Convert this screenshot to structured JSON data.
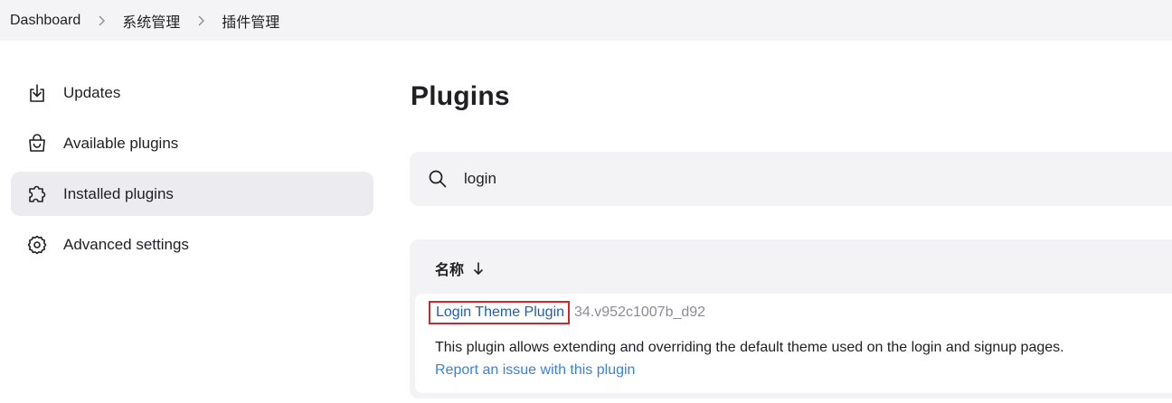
{
  "breadcrumb": {
    "items": [
      "Dashboard",
      "系统管理",
      "插件管理"
    ]
  },
  "sidebar": {
    "items": [
      {
        "label": "Updates",
        "icon": "download-icon",
        "active": false
      },
      {
        "label": "Available plugins",
        "icon": "shopping-bag-icon",
        "active": false
      },
      {
        "label": "Installed plugins",
        "icon": "puzzle-icon",
        "active": true
      },
      {
        "label": "Advanced settings",
        "icon": "gear-icon",
        "active": false
      }
    ]
  },
  "main": {
    "title": "Plugins",
    "search": {
      "value": "login",
      "icon": "search-icon"
    },
    "table": {
      "column_header": "名称",
      "sort_icon": "arrow-down-icon",
      "rows": [
        {
          "name": "Login Theme Plugin",
          "version": "34.v952c1007b_d92",
          "description": "This plugin allows extending and overriding the default theme used on the login and signup pages.",
          "issue_link": "Report an issue with this plugin"
        }
      ]
    }
  },
  "colors": {
    "breadcrumb_bg": "#f4f4f6",
    "active_item_bg": "#ececf0",
    "link": "#1f5fb0",
    "highlight_border": "#d1242f",
    "secondary_link": "#3b82d6"
  }
}
